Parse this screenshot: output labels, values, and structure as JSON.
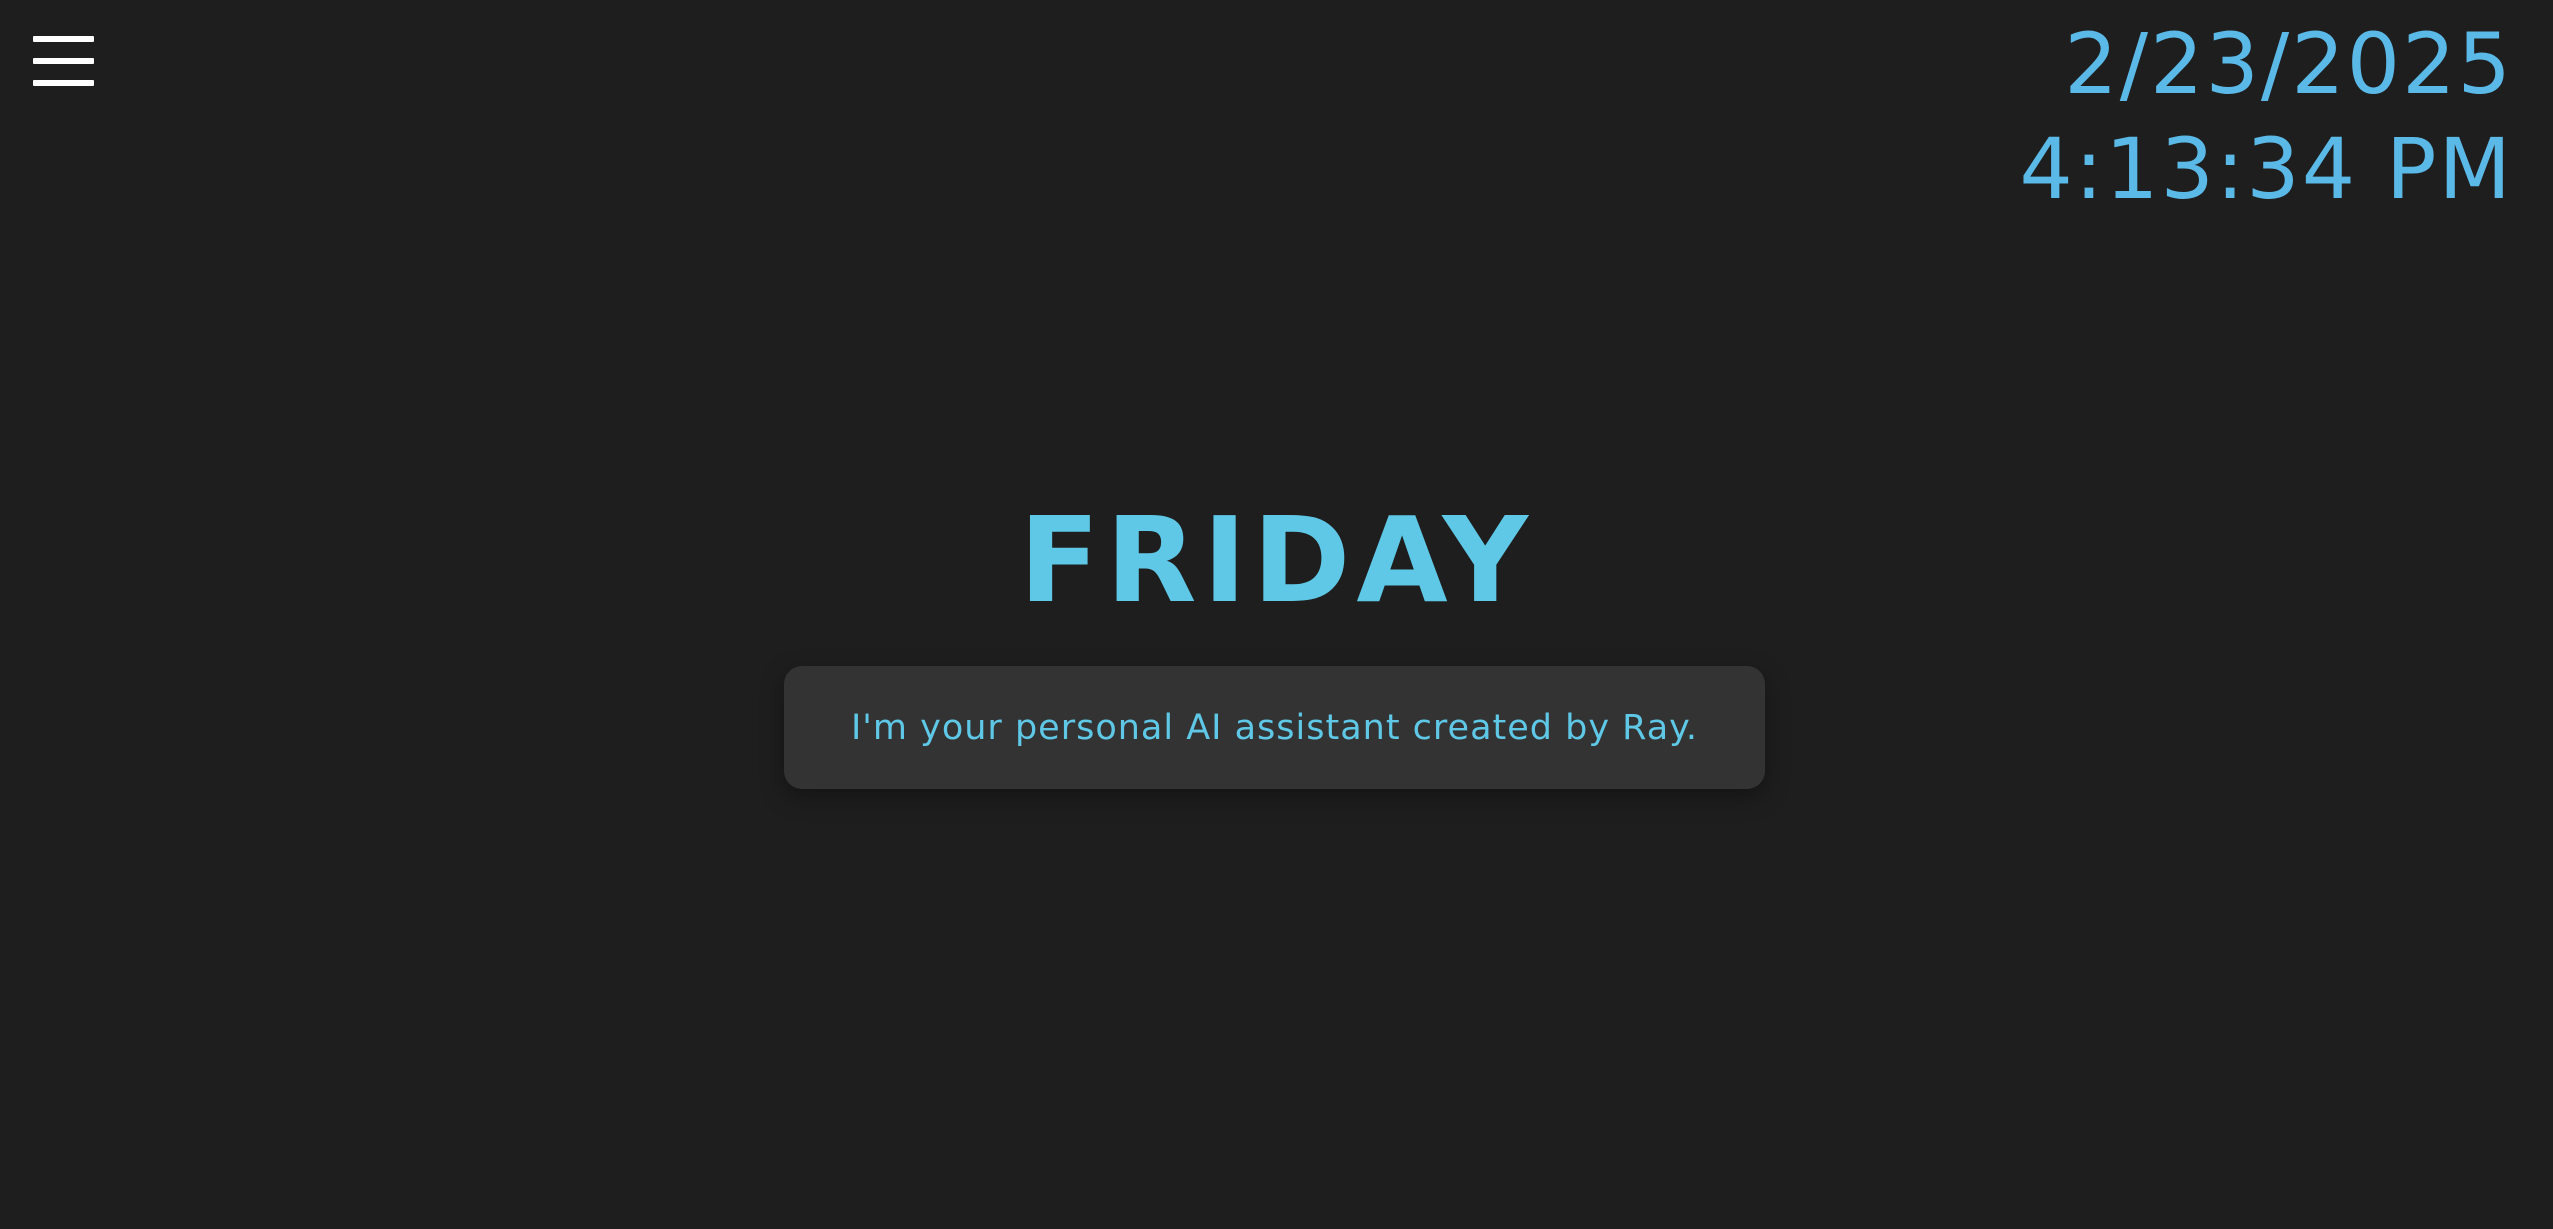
{
  "header": {
    "menu_icon": "hamburger-menu-icon",
    "date": "2/23/2025",
    "time": "4:13:34 PM"
  },
  "main": {
    "title": "FRIDAY",
    "message": "I'm your personal AI assistant created by Ray."
  },
  "colors": {
    "background": "#1e1e1e",
    "accent": "#5ec8e6",
    "clock": "#5bb9e8",
    "card": "#333333",
    "menu_icon": "#ffffff"
  }
}
